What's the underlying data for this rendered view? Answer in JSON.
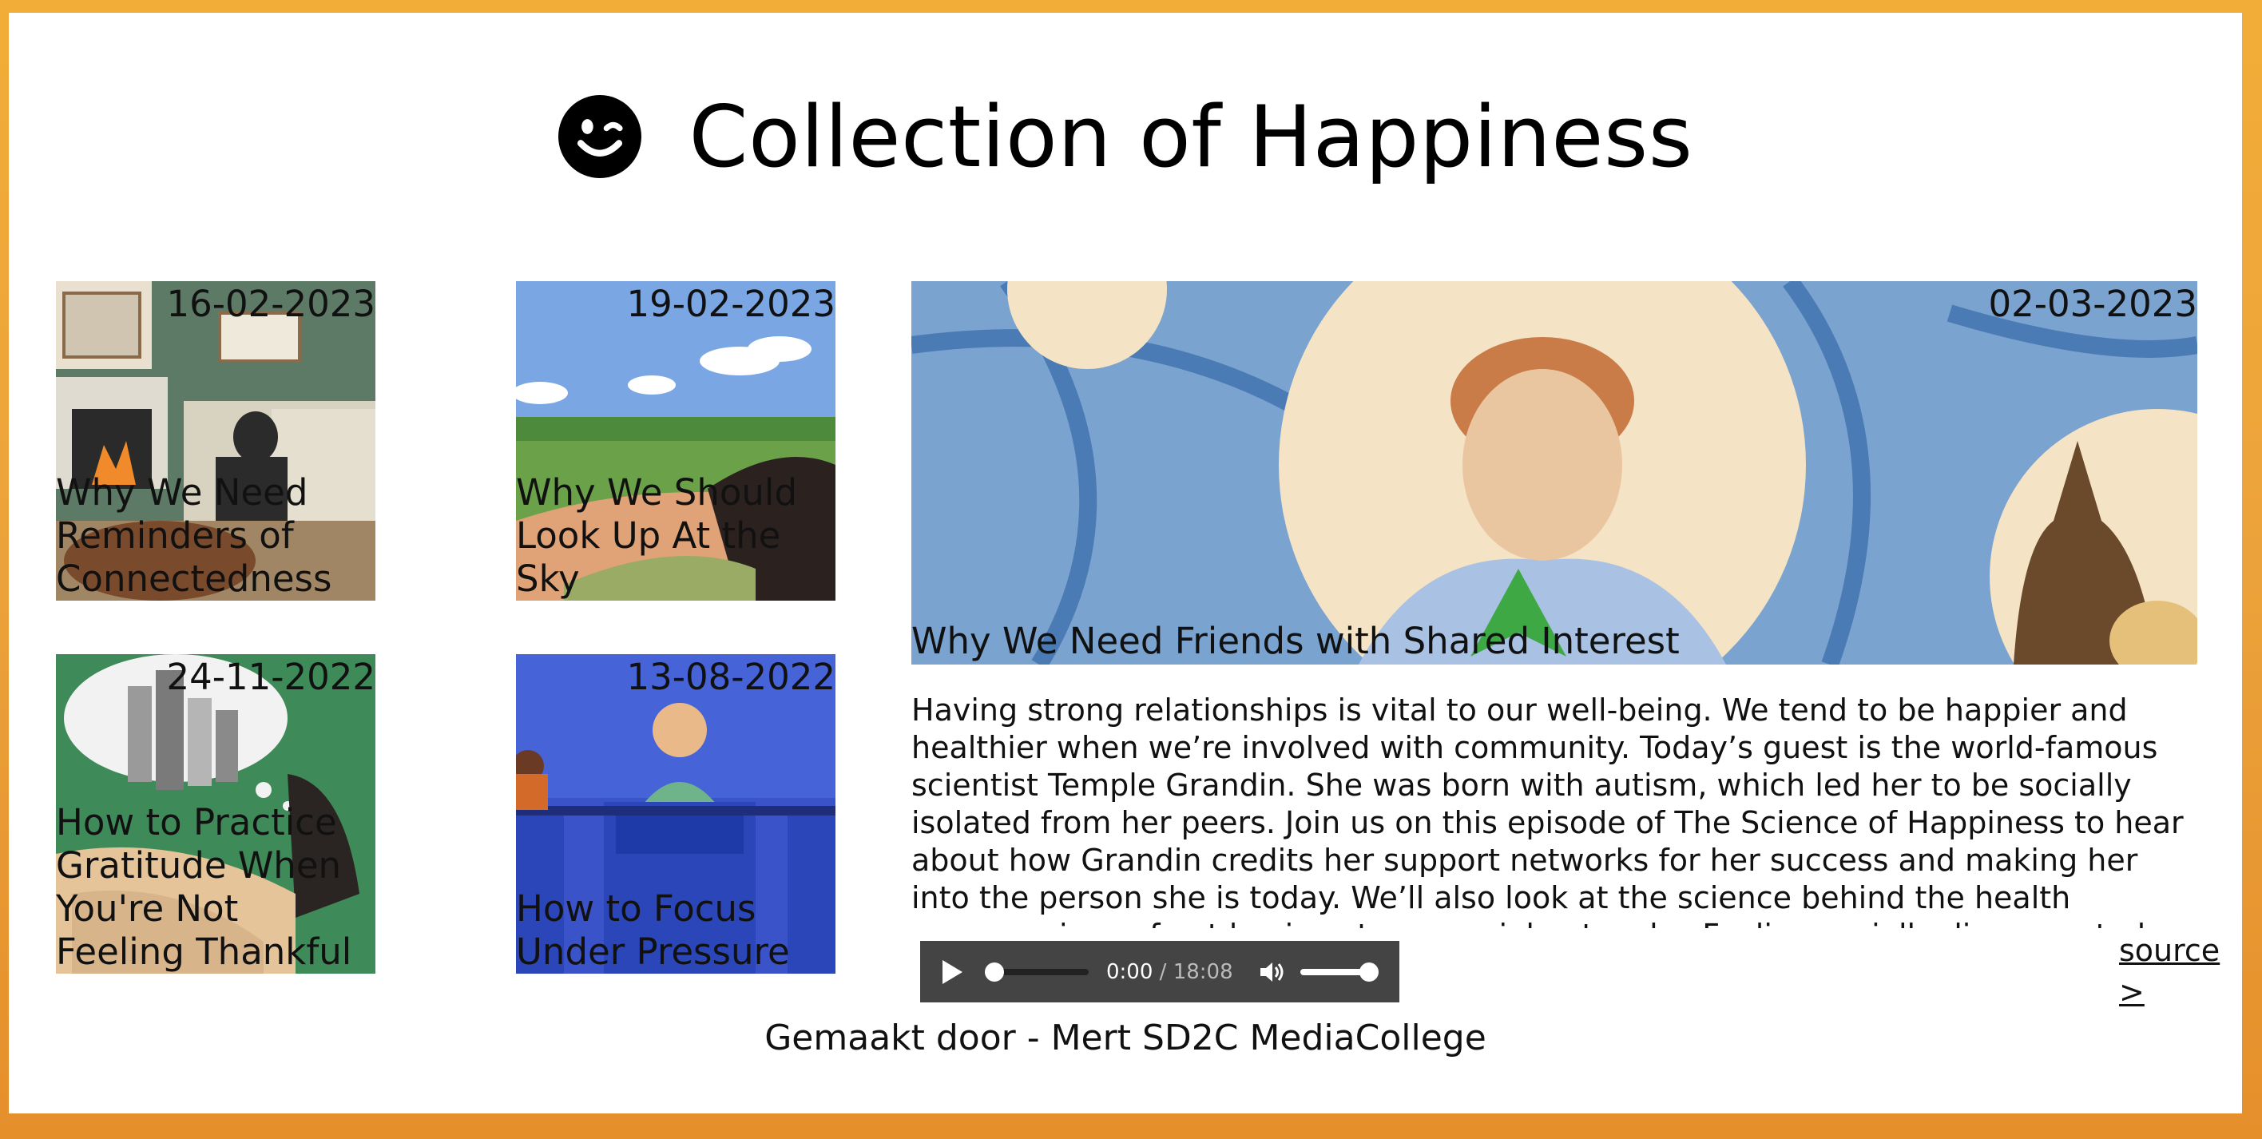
{
  "header": {
    "title": "Collection of Happiness",
    "icon": "winking-smiley-icon"
  },
  "cards": [
    {
      "date": "16-02-2023",
      "title": "Why We Need Reminders of Connectedness"
    },
    {
      "date": "19-02-2023",
      "title": "Why We Should Look Up At the Sky"
    },
    {
      "date": "24-11-2022",
      "title": "How to Practice Gratitude When You're Not Feeling Thankful"
    },
    {
      "date": "13-08-2022",
      "title": "How to Focus Under Pressure"
    }
  ],
  "feature": {
    "date": "02-03-2023",
    "title": "Why We Need Friends with Shared Interest",
    "description": "Having strong relationships is vital to our well-being. We tend to be happier and healthier when we’re involved with community. Today’s guest is the world-famous scientist Temple Grandin. She was born with autism, which led her to be socially isolated from her peers. Join us on this episode of The Science of Happiness to hear about how Grandin credits her support networks for her success and making her into the person she is today. We’ll also look at the science behind the health repercussions of not having strong social networks. Feeling socially disconnected can lead to a higher risk of"
  },
  "player": {
    "current_time": "0:00",
    "separator": " / ",
    "duration": "18:08",
    "progress": 0,
    "volume": 1
  },
  "source_link": "source >",
  "footer": "Gemaakt door - Mert SD2C MediaCollege",
  "colors": {
    "frame_top": "#f2ad38",
    "frame_bottom": "#e58f2b",
    "player_bg": "#444444"
  }
}
